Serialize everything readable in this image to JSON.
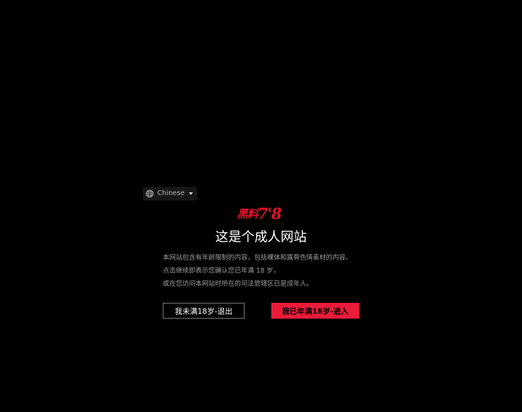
{
  "language_selector": {
    "icon": "globe-icon",
    "label": "Chinese",
    "caret_icon": "caret-down-icon"
  },
  "logo": {
    "text_cn": "黑料",
    "text_num": "7'8",
    "color": "#e8122a"
  },
  "title": "这是个成人网站",
  "description": [
    "本网站包含有年龄限制的内容，包括裸体和露骨色情素材的内容。",
    "点击继续即表示您确认您已年满 18 岁，",
    "或在您访问本网站时所在的司法管辖区已是成年人。"
  ],
  "buttons": {
    "exit_label": "我未满18岁-退出",
    "enter_label": "我已年满18岁-进入",
    "enter_color": "#ea1c3a"
  }
}
